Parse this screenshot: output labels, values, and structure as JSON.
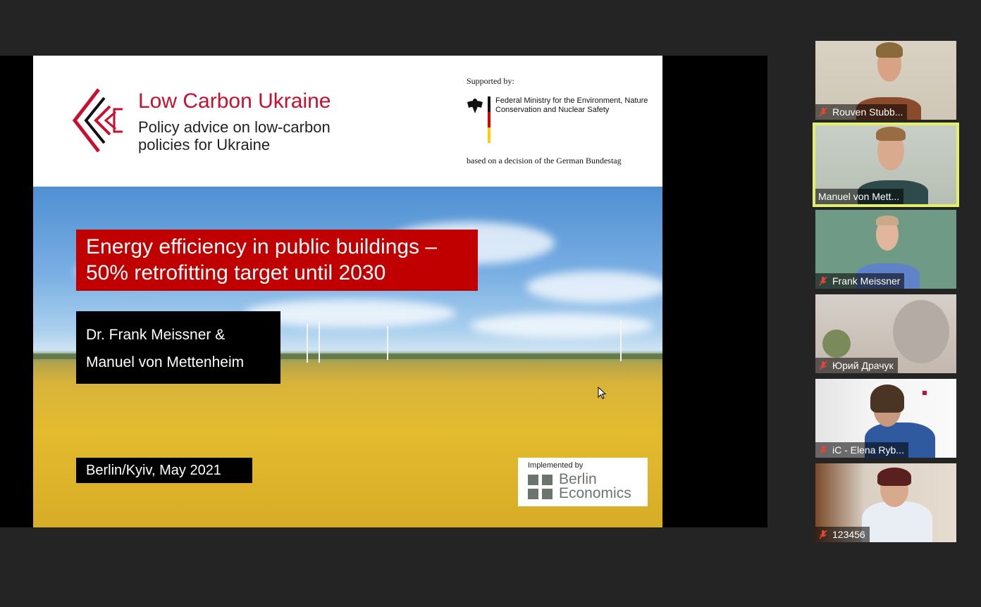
{
  "slide": {
    "org_title": "Low Carbon Ukraine",
    "org_subtitle": "Policy advice on low-carbon policies for Ukraine",
    "supported_by_label": "Supported by:",
    "ministry": "Federal Ministry for the Environment, Nature Conservation and Nuclear Safety",
    "bundestag_note": "based on a decision of the German Bundestag",
    "title": "Energy efficiency in public buildings – 50% retrofitting target until 2030",
    "authors_line1": "Dr. Frank Meissner &",
    "authors_line2": "Manuel von Mettenheim",
    "place_date": "Berlin/Kyiv, May 2021",
    "implemented_by_label": "Implemented by",
    "implementer_line1": "Berlin",
    "implementer_line2": "Economics",
    "brand_color": "#c8102e",
    "title_box_color": "#c00000"
  },
  "participants": [
    {
      "name": "Rouven Stubb...",
      "muted": true,
      "active": false
    },
    {
      "name": "Manuel von Mett...",
      "muted": false,
      "active": true
    },
    {
      "name": "Frank Meissner",
      "muted": true,
      "active": false
    },
    {
      "name": "Юрий Драчук",
      "muted": true,
      "active": false
    },
    {
      "name": "iC - Elena Ryb...",
      "muted": true,
      "active": false
    },
    {
      "name": "123456",
      "muted": true,
      "active": false
    }
  ],
  "colors": {
    "active_speaker_border": "#e1ef6b",
    "muted_icon": "#e0453a",
    "background": "#242424"
  }
}
